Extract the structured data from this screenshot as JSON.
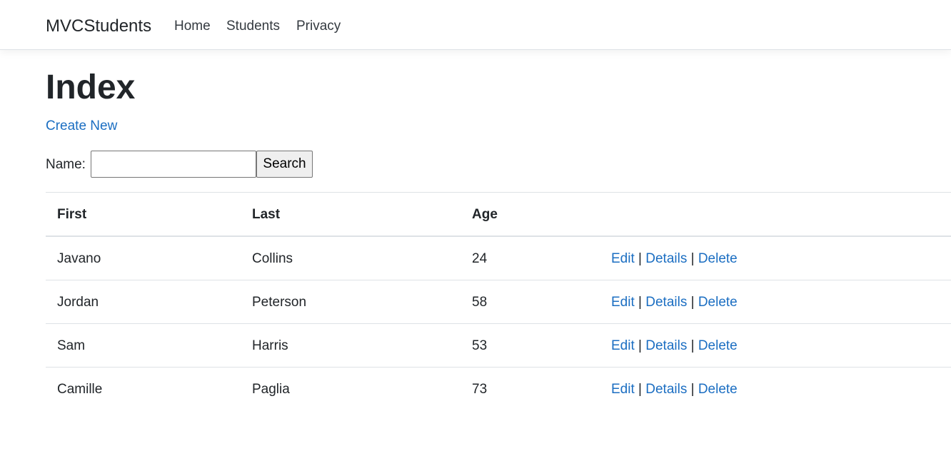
{
  "nav": {
    "brand": "MVCStudents",
    "links": [
      "Home",
      "Students",
      "Privacy"
    ]
  },
  "page": {
    "title": "Index",
    "create_link": "Create New"
  },
  "search": {
    "label": "Name:",
    "value": "",
    "button_label": "Search"
  },
  "table": {
    "headers": [
      "First",
      "Last",
      "Age",
      ""
    ],
    "rows": [
      {
        "first": "Javano",
        "last": "Collins",
        "age": "24"
      },
      {
        "first": "Jordan",
        "last": "Peterson",
        "age": "58"
      },
      {
        "first": "Sam",
        "last": "Harris",
        "age": "53"
      },
      {
        "first": "Camille",
        "last": "Paglia",
        "age": "73"
      }
    ],
    "actions": {
      "edit": "Edit",
      "details": "Details",
      "delete": "Delete",
      "separator": "|"
    }
  },
  "colors": {
    "link": "#1b6ec2",
    "text": "#212529",
    "border": "#dee2e6"
  }
}
